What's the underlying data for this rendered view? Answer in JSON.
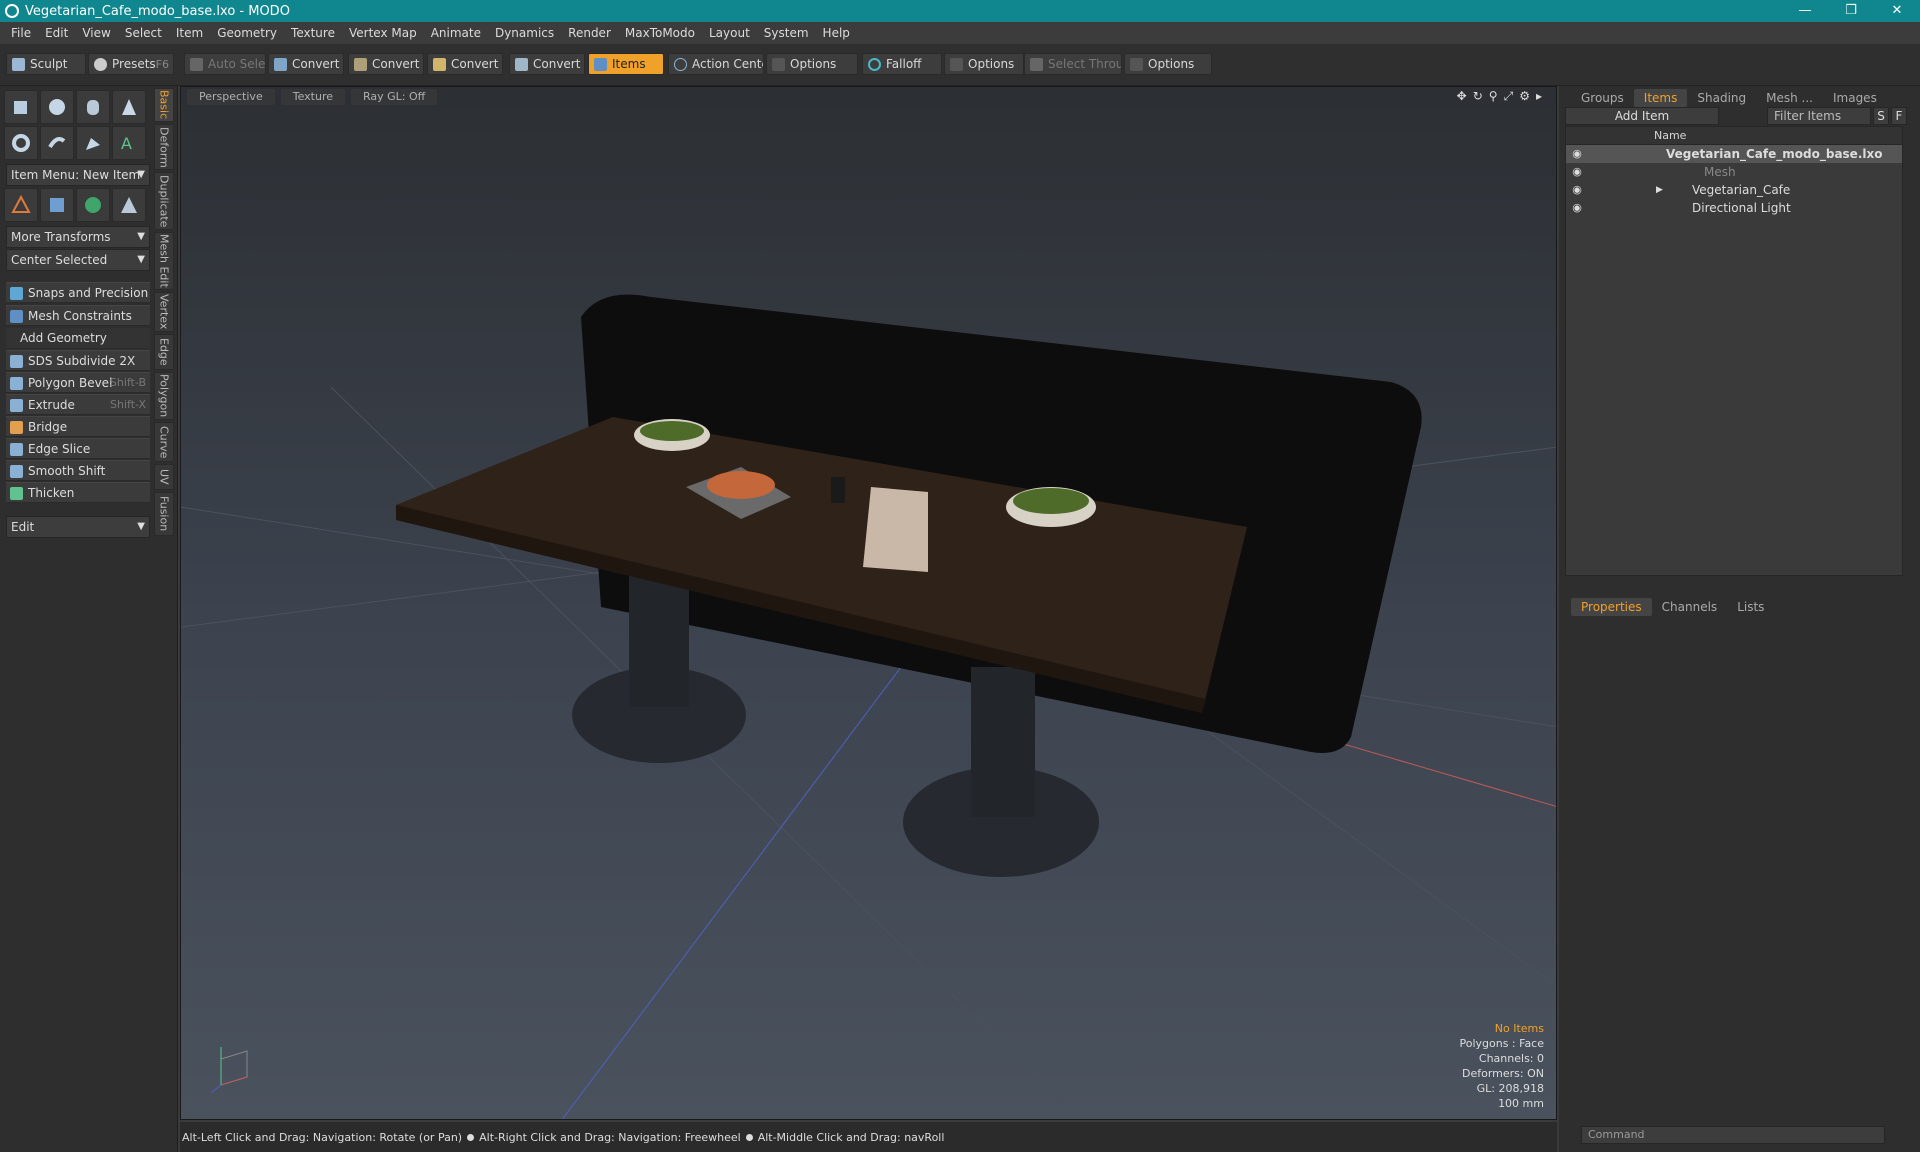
{
  "window": {
    "title": "Vegetarian_Cafe_modo_base.lxo - MODO",
    "buttons": [
      "—",
      "❐",
      "✕"
    ]
  },
  "menu": [
    "File",
    "Edit",
    "View",
    "Select",
    "Item",
    "Geometry",
    "Texture",
    "Vertex Map",
    "Animate",
    "Dynamics",
    "Render",
    "MaxToModo",
    "Layout",
    "System",
    "Help"
  ],
  "toolbar": {
    "sculpt": "Sculpt",
    "presets": "Presets",
    "presets_key": "F6",
    "auto_select": "Auto Select",
    "convert": "Convert",
    "items": "Items",
    "action_center": "Action Center",
    "options": "Options",
    "falloff": "Falloff",
    "select_through": "Select Through"
  },
  "left": {
    "item_menu": "Item Menu: New Item",
    "more_transforms": "More Transforms",
    "center_selected": "Center Selected",
    "snaps": "Snaps and Precision",
    "mesh_constraints": "Mesh Constraints",
    "add_geometry": "Add Geometry",
    "tools": [
      {
        "label": "SDS Subdivide 2X",
        "key": ""
      },
      {
        "label": "Polygon Bevel",
        "key": "Shift-B"
      },
      {
        "label": "Extrude",
        "key": "Shift-X"
      },
      {
        "label": "Bridge",
        "key": ""
      },
      {
        "label": "Edge Slice",
        "key": ""
      },
      {
        "label": "Smooth Shift",
        "key": ""
      },
      {
        "label": "Thicken",
        "key": ""
      }
    ],
    "edit": "Edit",
    "vtabs": [
      "Basic",
      "Deform",
      "Duplicate",
      "Mesh Edit",
      "Vertex",
      "Edge",
      "Polygon",
      "Curve",
      "UV",
      "Fusion"
    ]
  },
  "viewport": {
    "perspective": "Perspective",
    "texture": "Texture",
    "raygl": "Ray GL: Off",
    "info": {
      "no_items": "No Items",
      "polygons": "Polygons : Face",
      "channels": "Channels: 0",
      "deformers": "Deformers: ON",
      "gl": "GL: 208,918",
      "scale": "100 mm"
    }
  },
  "status": {
    "hint1": "Alt-Left Click and Drag: Navigation: Rotate (or Pan)",
    "hint2": "Alt-Right Click and Drag: Navigation: Freewheel",
    "hint3": "Alt-Middle Click and Drag: navRoll"
  },
  "right": {
    "tabs": [
      "Groups",
      "Items",
      "Shading",
      "Mesh ...",
      "Images"
    ],
    "add_item": "Add Item",
    "filter": "Filter Items",
    "s": "S",
    "f": "F",
    "name_col": "Name",
    "tree": [
      "Vegetarian_Cafe_modo_base.lxo",
      "Mesh",
      "Vegetarian_Cafe",
      "Directional Light"
    ],
    "prop_tabs": [
      "Properties",
      "Channels",
      "Lists"
    ],
    "command_placeholder": "Command"
  }
}
